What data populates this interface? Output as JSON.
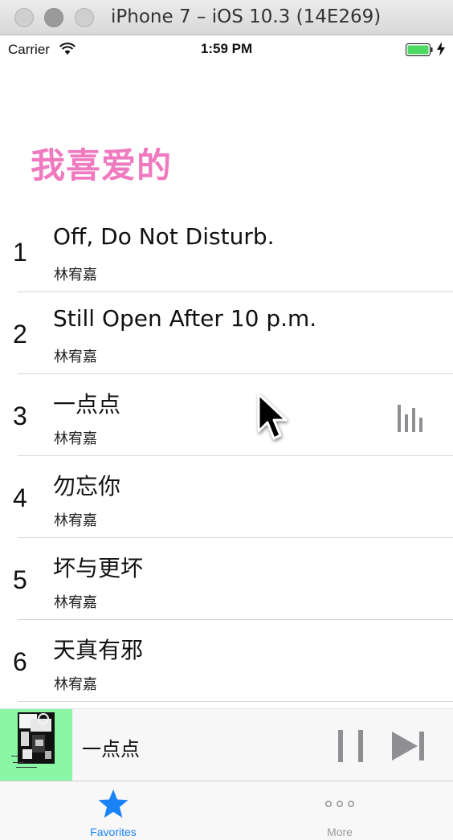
{
  "window": {
    "title": "iPhone 7 – iOS 10.3 (14E269)"
  },
  "status_bar": {
    "carrier": "Carrier",
    "time": "1:59 PM"
  },
  "page": {
    "title": "我喜爱的"
  },
  "songs": [
    {
      "index": "1",
      "title": "Off, Do Not Disturb.",
      "artist": "林宥嘉"
    },
    {
      "index": "2",
      "title": "Still Open After 10 p.m.",
      "artist": "林宥嘉"
    },
    {
      "index": "3",
      "title": "一点点",
      "artist": "林宥嘉",
      "playing": true
    },
    {
      "index": "4",
      "title": "勿忘你",
      "artist": "林宥嘉"
    },
    {
      "index": "5",
      "title": "坏与更坏",
      "artist": "林宥嘉"
    },
    {
      "index": "6",
      "title": "天真有邪",
      "artist": "林宥嘉"
    }
  ],
  "mini_player": {
    "title": "一点点"
  },
  "tab_bar": {
    "items": [
      {
        "label": "Favorites",
        "icon": "star-icon",
        "selected": true
      },
      {
        "label": "More",
        "icon": "ellipsis-icon",
        "selected": false
      }
    ]
  },
  "colors": {
    "accent": "#1a82f7",
    "title_pink": "#f07ac0",
    "album_bg": "#8af7a6"
  }
}
